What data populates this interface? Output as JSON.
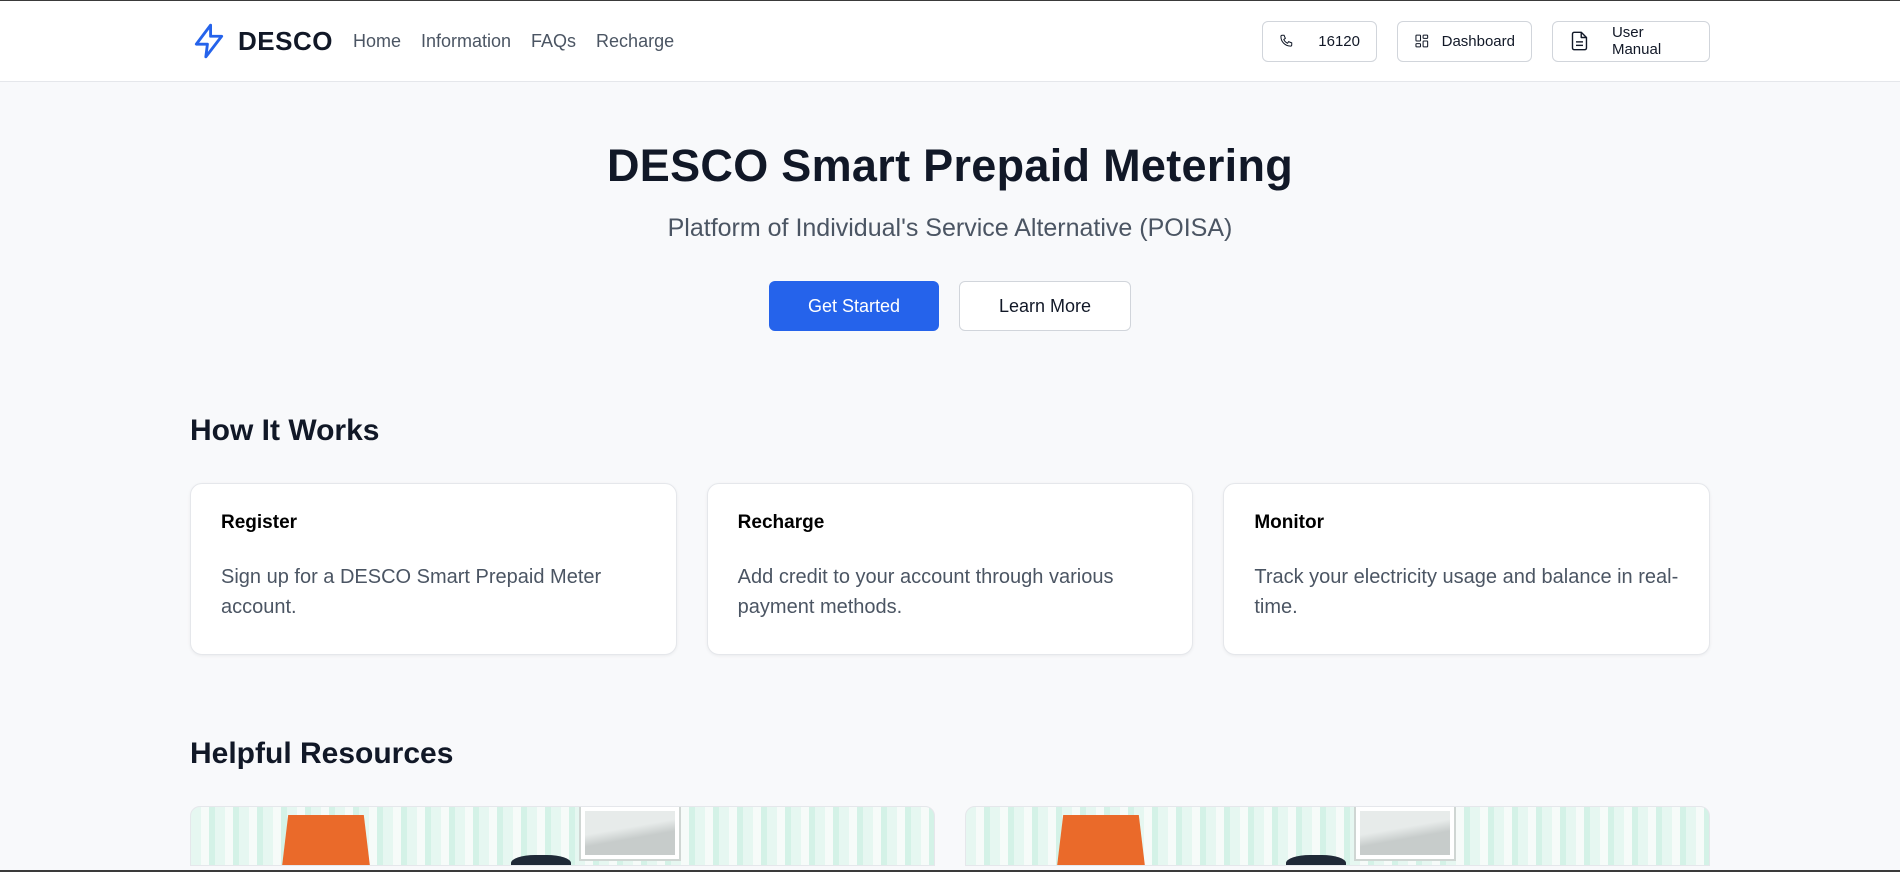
{
  "nav": {
    "brand": "DESCO",
    "links": [
      "Home",
      "Information",
      "FAQs",
      "Recharge"
    ],
    "phone": "16120",
    "dashboard": "Dashboard",
    "manual": "User Manual"
  },
  "hero": {
    "title": "DESCO Smart Prepaid Metering",
    "subtitle": "Platform of Individual's Service Alternative (POISA)",
    "primary": "Get Started",
    "secondary": "Learn More"
  },
  "how": {
    "title": "How It Works",
    "cards": [
      {
        "title": "Register",
        "desc": "Sign up for a DESCO Smart Prepaid Meter account."
      },
      {
        "title": "Recharge",
        "desc": "Add credit to your account through various payment methods."
      },
      {
        "title": "Monitor",
        "desc": "Track your electricity usage and balance in real-time."
      }
    ]
  },
  "resources": {
    "title": "Helpful Resources"
  },
  "colors": {
    "accent": "#2563eb",
    "brand_icon": "#2563eb"
  },
  "icons": {
    "brand": "lightning-icon",
    "phone": "phone-icon",
    "dashboard": "dashboard-icon",
    "manual": "document-icon"
  }
}
